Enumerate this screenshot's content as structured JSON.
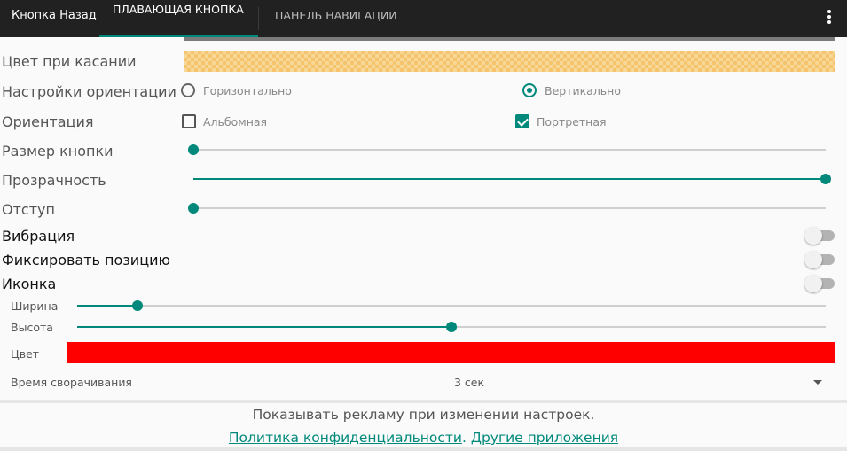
{
  "app_bar": {
    "title": "Кнопка Назад",
    "tabs": [
      {
        "label": "ПЛАВАЮЩАЯ КНОПКА",
        "active": true
      },
      {
        "label": "ПАНЕЛЬ НАВИГАЦИИ",
        "active": false
      }
    ],
    "menu_icon": "more-vert-icon"
  },
  "settings": {
    "touch_color_label": "Цвет при касании",
    "orientation_settings": {
      "label": "Настройки ориентации",
      "options": [
        {
          "label": "Горизонтально",
          "selected": false
        },
        {
          "label": "Вертикально",
          "selected": true
        }
      ]
    },
    "orientation": {
      "label": "Ориентация",
      "options": [
        {
          "label": "Альбомная",
          "checked": false
        },
        {
          "label": "Портретная",
          "checked": true
        }
      ]
    },
    "button_size": {
      "label": "Размер кнопки",
      "value_fraction": 0.0
    },
    "transparency": {
      "label": "Прозрачность",
      "value_fraction": 1.0
    },
    "offset": {
      "label": "Отступ",
      "value_fraction": 0.0
    },
    "vibration": {
      "label": "Вибрация",
      "on": false
    },
    "fix_position": {
      "label": "Фиксировать позицию",
      "on": false
    },
    "icon": {
      "label": "Иконка",
      "on": false
    },
    "width": {
      "label": "Ширина",
      "value_fraction": 0.08
    },
    "height": {
      "label": "Высота",
      "value_fraction": 0.5
    },
    "color": {
      "label": "Цвет",
      "value": "#ff0000"
    },
    "collapse_time": {
      "label": "Время сворачивания",
      "value": "3 сек"
    }
  },
  "footer": {
    "ad_notice": "Показывать рекламу при изменении настроек.",
    "privacy_link": "Политика конфиденциальности",
    "separator": ".",
    "other_apps_link": "Другие приложения"
  },
  "colors": {
    "accent": "#00897b",
    "app_bar": "#212121",
    "color_swatch": "#ff0000"
  }
}
